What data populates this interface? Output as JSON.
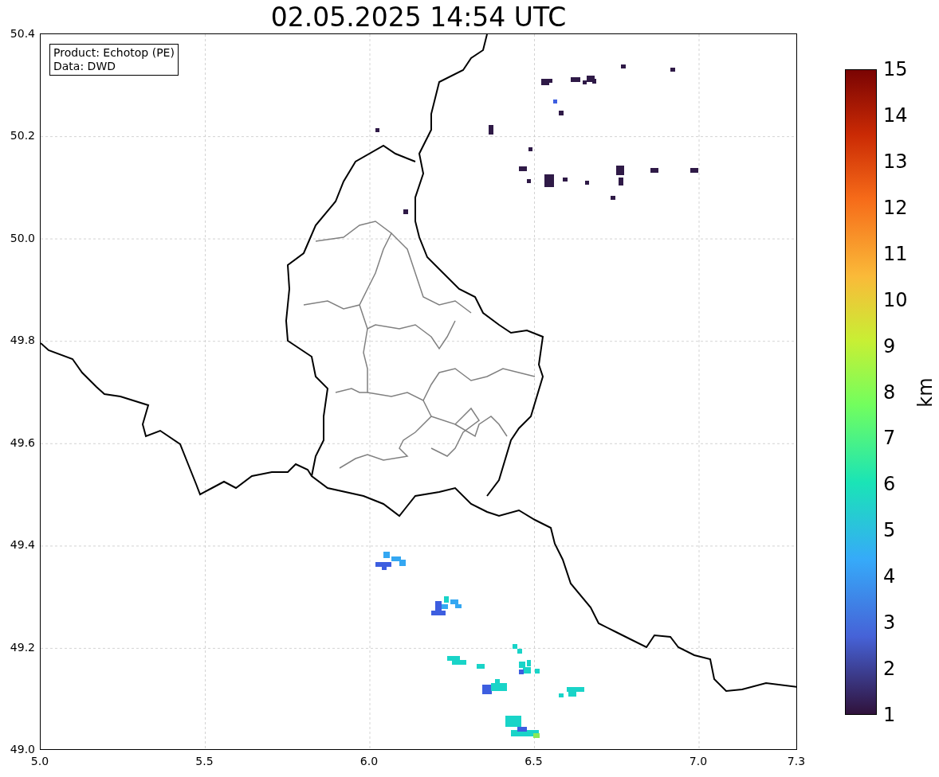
{
  "title": "02.05.2025 14:54 UTC",
  "info_box": [
    "Product: Echotop (PE)",
    "Data: DWD"
  ],
  "map": {
    "y_ticks": [
      "50.4",
      "50.2",
      "50.0",
      "49.8",
      "49.6",
      "49.4",
      "49.2",
      "49.0"
    ],
    "x_ticks": [
      "5.0",
      "5.5",
      "6.0",
      "6.5",
      "7.0",
      "7.3"
    ]
  },
  "colorbar": {
    "ticks": [
      "15",
      "14",
      "13",
      "12",
      "11",
      "10",
      "9",
      "8",
      "7",
      "6",
      "5",
      "4",
      "3",
      "2",
      "1"
    ],
    "label": "km"
  }
}
